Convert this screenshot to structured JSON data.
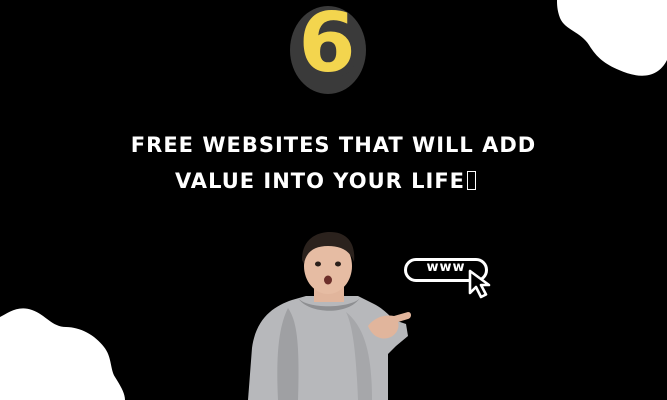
{
  "badge": {
    "number": "6"
  },
  "headline": {
    "line1": "FREE WEBSITES THAT WILL ADD",
    "line2": "VALUE INTO YOUR LIFE"
  },
  "url_badge": {
    "text": "www"
  },
  "icons": [
    "blob-shape",
    "cursor-arrow-icon",
    "glyph-box"
  ],
  "colors": {
    "background": "#000000",
    "badge_yellow": "#f3d54e",
    "badge_shadow": "#3a3a3a",
    "text": "#ffffff"
  }
}
